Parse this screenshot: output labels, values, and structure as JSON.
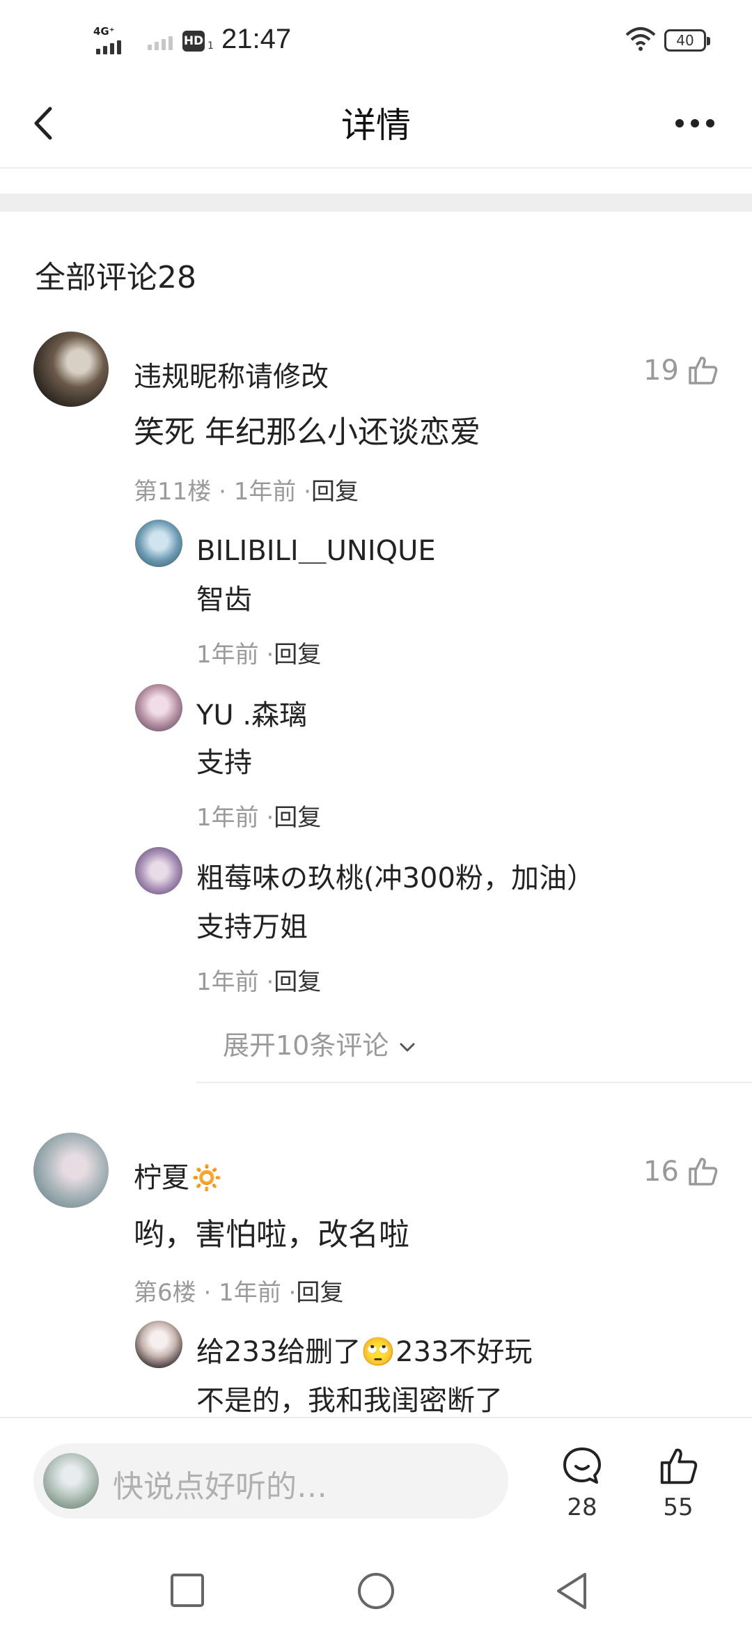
{
  "status_bar": {
    "network": "4G⁺",
    "hd_label": "HD",
    "hd_sub": "1",
    "time": "21:47",
    "battery": "40"
  },
  "header": {
    "title": "详情"
  },
  "comments_section": {
    "title": "全部评论28"
  },
  "comments": [
    {
      "name": "违规昵称请修改",
      "text": "笑死 年纪那么小还谈恋爱",
      "floor": "第11楼",
      "time": "1年前",
      "reply_label": "回复",
      "likes": "19",
      "replies": [
        {
          "name": "BILIBILI＿UNIQUE",
          "text": "智齿",
          "time": "1年前",
          "reply_label": "回复"
        },
        {
          "name": "YU .森璃",
          "text": "支持",
          "time": "1年前",
          "reply_label": "回复"
        },
        {
          "name": "粗莓味の玖桃(冲300粉，加油）",
          "text": "支持万姐",
          "time": "1年前",
          "reply_label": "回复"
        }
      ],
      "expand_label": "展开10条评论"
    },
    {
      "name": "柠夏",
      "name_emoji": "🔅",
      "text": "哟，害怕啦，改名啦",
      "floor": "第6楼",
      "time": "1年前",
      "reply_label": "回复",
      "likes": "16",
      "replies": [
        {
          "name": "给233给删了",
          "name_emoji": "🙄",
          "name_suffix": "233不好玩",
          "text": "不是的，我和我闺密断了"
        }
      ]
    }
  ],
  "bottom_bar": {
    "input_placeholder": "快说点好听的…",
    "comment_count": "28",
    "like_count": "55"
  },
  "icons": {
    "back": "chevron-left-icon",
    "more": "more-dots-icon",
    "like": "thumbs-up-icon",
    "comment": "comment-bubble-icon",
    "expand": "chevron-down-icon",
    "nav_recent": "square-icon",
    "nav_home": "circle-icon",
    "nav_back": "triangle-back-icon"
  }
}
